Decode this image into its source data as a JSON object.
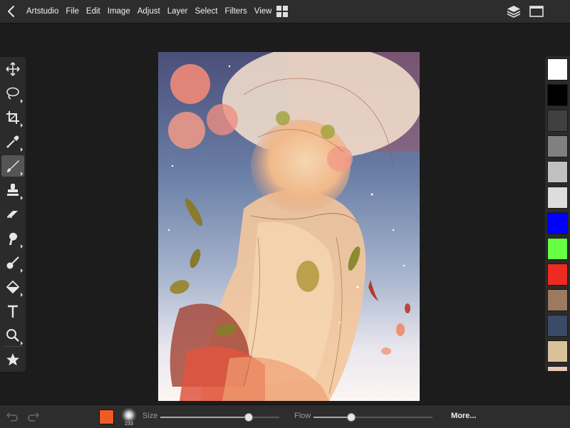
{
  "menu": {
    "items": [
      "Artstudio",
      "File",
      "Edit",
      "Image",
      "Adjust",
      "Layer",
      "Select",
      "Filters",
      "View"
    ]
  },
  "tools": [
    {
      "name": "move-tool",
      "icon": "move-icon",
      "active": false,
      "has_submenu": false
    },
    {
      "name": "lasso-tool",
      "icon": "lasso-icon",
      "active": false,
      "has_submenu": true
    },
    {
      "name": "crop-tool",
      "icon": "crop-icon",
      "active": false,
      "has_submenu": true
    },
    {
      "name": "eyedropper-tool",
      "icon": "eyedropper-icon",
      "active": false,
      "has_submenu": true
    },
    {
      "name": "brush-tool",
      "icon": "brush-icon",
      "active": true,
      "has_submenu": true
    },
    {
      "name": "stamp-tool",
      "icon": "stamp-icon",
      "active": false,
      "has_submenu": true
    },
    {
      "name": "eraser-tool",
      "icon": "eraser-icon",
      "active": false,
      "has_submenu": false
    },
    {
      "name": "smudge-tool",
      "icon": "smudge-icon",
      "active": false,
      "has_submenu": true
    },
    {
      "name": "dodge-tool",
      "icon": "dodge-icon",
      "active": false,
      "has_submenu": true
    },
    {
      "name": "fill-tool",
      "icon": "fill-icon",
      "active": false,
      "has_submenu": true
    },
    {
      "name": "text-tool",
      "icon": "text-icon",
      "active": false,
      "has_submenu": false
    },
    {
      "name": "zoom-tool",
      "icon": "zoom-icon",
      "active": false,
      "has_submenu": true
    },
    {
      "name": "favorites-tool",
      "icon": "star-icon",
      "active": false,
      "has_submenu": false
    }
  ],
  "palette": [
    "#ffffff",
    "#000000",
    "#404040",
    "#808080",
    "#c0c0c0",
    "#dddddd",
    "#0000ff",
    "#66ff44",
    "#ee2b22",
    "#9b7a5f",
    "#3b4a66",
    "#d9c29a",
    "#e8c8b8"
  ],
  "bottom": {
    "current_color": "#f05a23",
    "brush_size_number": "233",
    "size_label": "Size",
    "size_value": 0.74,
    "flow_label": "Flow",
    "flow_value": 0.32,
    "more_label": "More..."
  }
}
